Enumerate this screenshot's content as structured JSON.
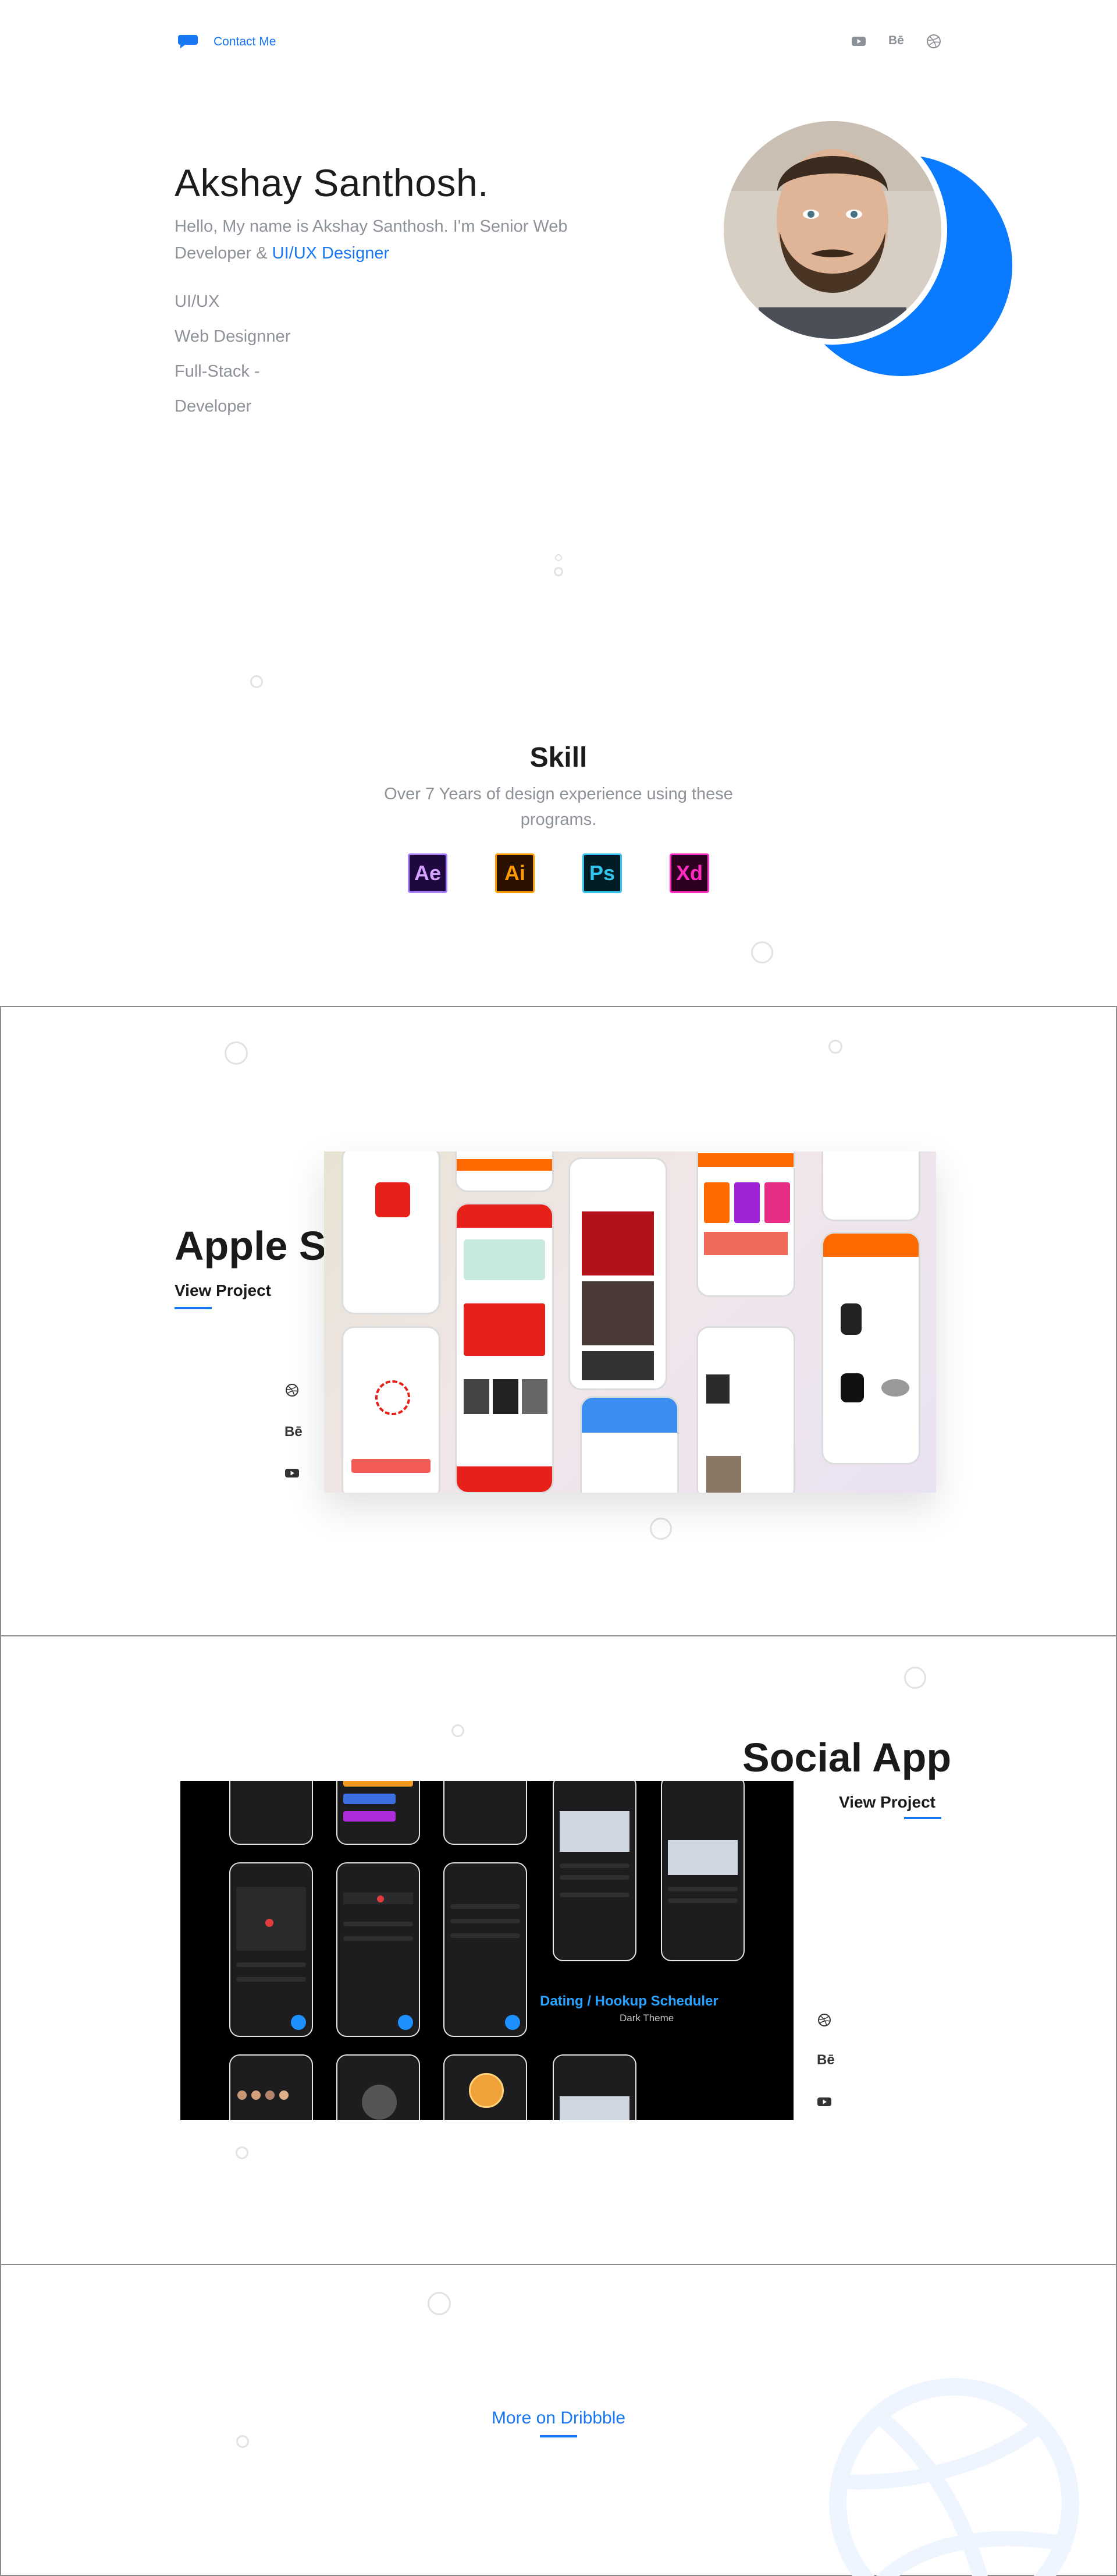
{
  "header": {
    "contact_label": "Contact Me",
    "social_icons": [
      "youtube-icon",
      "behance-icon",
      "dribbble-icon"
    ],
    "behance_glyph": "Bē"
  },
  "hero": {
    "name": "Akshay Santhosh.",
    "intro_prefix": "Hello, My name is Akshay Santhosh. I'm Senior Web Developer & ",
    "intro_accent": "UI/UX Designer",
    "roles": [
      "UI/UX",
      "Web Designner",
      "Full-Stack -",
      "Developer"
    ]
  },
  "skills": {
    "title": "Skill",
    "subtitle": "Over 7 Years of design experience using these programs.",
    "tools": [
      "Ae",
      "Ai",
      "Ps",
      "Xd"
    ]
  },
  "projects": [
    {
      "title": "Apple Store",
      "link_label": "View Project",
      "social_icons": [
        "dribbble-icon",
        "behance-icon",
        "youtube-icon"
      ]
    },
    {
      "title": "Social App",
      "link_label": "View Project",
      "social_icons": [
        "dribbble-icon",
        "behance-icon",
        "youtube-icon"
      ],
      "shot_title": "Dating / Hookup Scheduler",
      "shot_subtitle": "Dark Theme"
    }
  ],
  "more": {
    "label": "More on Dribbble"
  },
  "colors": {
    "accent": "#1877f2",
    "hero_blob": "#0a7aff",
    "muted_text": "#8d9198"
  }
}
